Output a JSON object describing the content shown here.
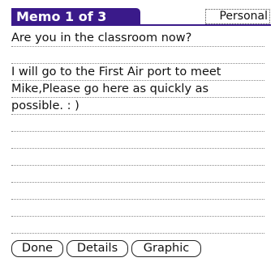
{
  "header": {
    "title": "Memo 1 of 3",
    "category": "Personal"
  },
  "memo": {
    "lines": [
      "Are  you in the classroom now?",
      "",
      "I will go to the First Air port  to meet",
      "Mike,Please go here as quickly as",
      "possible. : )",
      "",
      "",
      "",
      "",
      "",
      "",
      ""
    ]
  },
  "buttons": {
    "done": "Done",
    "details": "Details",
    "graphic": "Graphic"
  },
  "colors": {
    "title_bar": "#3a1a8a",
    "title_text": "#ffffff"
  }
}
